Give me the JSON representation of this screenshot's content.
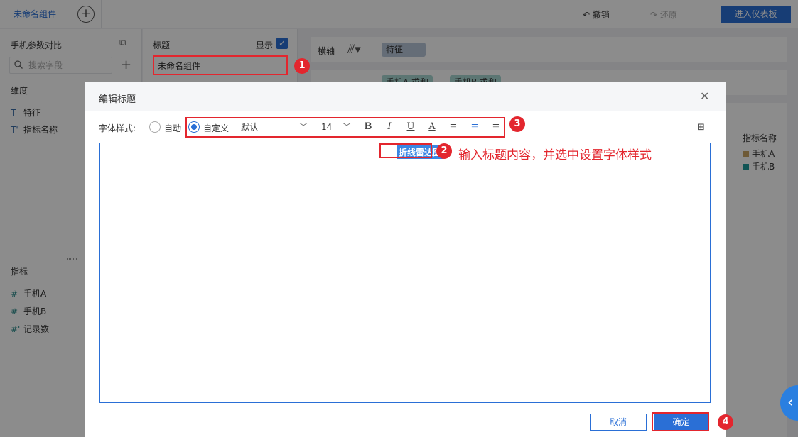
{
  "topbar": {
    "tab_label": "未命名组件",
    "add_tab": "+",
    "undo_label": "撤销",
    "redo_label": "还原",
    "dashboard_button": "进入仪表板"
  },
  "left_panel": {
    "dataset_name": "手机参数对比",
    "search_placeholder": "搜索字段",
    "dimensions_title": "维度",
    "dimensions": [
      {
        "icon": "T",
        "label": "特征"
      },
      {
        "icon": "T'",
        "label": "指标名称"
      }
    ],
    "measures_title": "指标",
    "measures": [
      {
        "icon": "#",
        "label": "手机A"
      },
      {
        "icon": "#",
        "label": "手机B"
      },
      {
        "icon": "#'",
        "label": "记录数"
      }
    ]
  },
  "mid_panel": {
    "title_label": "标题",
    "show_label": "显示",
    "title_value": "未命名组件"
  },
  "config": {
    "horizontal_axis_label": "横轴",
    "horizontal_pill": "特征",
    "vertical_pills": [
      "手机A·求和",
      "手机B·求和"
    ]
  },
  "legend": {
    "title": "指标名称",
    "items": [
      {
        "label": "手机A",
        "color": "#c9a565"
      },
      {
        "label": "手机B",
        "color": "#1f9a9a"
      }
    ]
  },
  "dialog": {
    "title": "编辑标题",
    "font_style_label": "字体样式:",
    "auto_label": "自动",
    "custom_label": "自定义",
    "font_family": "默认",
    "font_size": "14",
    "editor_text": "折线雷达图",
    "cancel_label": "取消",
    "ok_label": "确定"
  },
  "annotations": {
    "badges": [
      "1",
      "2",
      "3",
      "4"
    ],
    "step2_text": "输入标题内容，并选中设置字体样式"
  },
  "colors": {
    "accent": "#2a6fd6",
    "annotation_red": "#e3262e"
  }
}
